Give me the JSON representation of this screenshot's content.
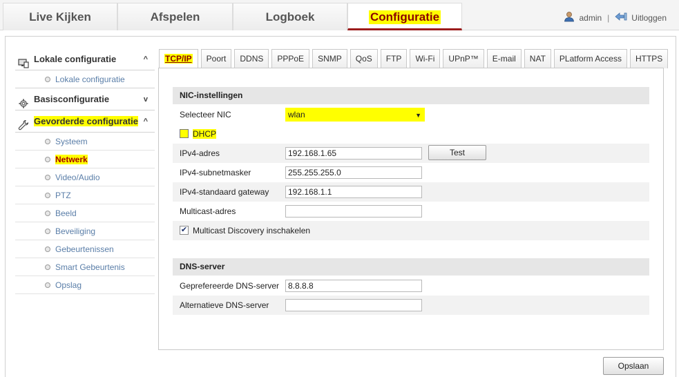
{
  "nav": {
    "tabs": [
      {
        "label": "Live Kijken",
        "active": false
      },
      {
        "label": "Afspelen",
        "active": false
      },
      {
        "label": "Logboek",
        "active": false
      },
      {
        "label": "Configuratie",
        "active": true
      }
    ],
    "user": "admin",
    "separator": "|",
    "logout": "Uitloggen"
  },
  "sidebar": {
    "groups": [
      {
        "label": "Lokale configuratie",
        "icon": "monitor-icon",
        "chevron": "^",
        "items": [
          {
            "label": "Lokale configuratie"
          }
        ]
      },
      {
        "label": "Basisconfiguratie",
        "icon": "gear-icon",
        "chevron": "v",
        "items": []
      },
      {
        "label": "Gevorderde configuratie",
        "icon": "wrench-icon",
        "chevron": "^",
        "items": [
          {
            "label": "Systeem"
          },
          {
            "label": "Netwerk",
            "active": true
          },
          {
            "label": "Video/Audio"
          },
          {
            "label": "PTZ"
          },
          {
            "label": "Beeld"
          },
          {
            "label": "Beveiliging"
          },
          {
            "label": "Gebeurtenissen"
          },
          {
            "label": "Smart Gebeurtenis"
          },
          {
            "label": "Opslag"
          }
        ]
      }
    ]
  },
  "tabs": [
    "TCP/IP",
    "Poort",
    "DDNS",
    "PPPoE",
    "SNMP",
    "QoS",
    "FTP",
    "Wi-Fi",
    "UPnP™",
    "E-mail",
    "NAT",
    "PLatform Access",
    "HTTPS"
  ],
  "active_tab": "TCP/IP",
  "nic_section": {
    "title": "NIC-instellingen",
    "select_nic_label": "Selecteer NIC",
    "select_nic_value": "wlan",
    "dhcp_label": "DHCP",
    "dhcp_checked": false,
    "ipv4_address_label": "IPv4-adres",
    "ipv4_address_value": "192.168.1.65",
    "test_button": "Test",
    "ipv4_subnet_label": "IPv4-subnetmasker",
    "ipv4_subnet_value": "255.255.255.0",
    "ipv4_gateway_label": "IPv4-standaard gateway",
    "ipv4_gateway_value": "192.168.1.1",
    "multicast_label": "Multicast-adres",
    "multicast_value": "",
    "multicast_discovery_label": "Multicast Discovery inschakelen",
    "multicast_discovery_checked": true
  },
  "dns_section": {
    "title": "DNS-server",
    "preferred_label": "Geprefereerde DNS-server",
    "preferred_value": "8.8.8.8",
    "alternate_label": "Alternatieve DNS-server",
    "alternate_value": ""
  },
  "save_button": "Opslaan",
  "colors": {
    "highlight": "#ffff00",
    "active_red": "#8b0000",
    "link_blue": "#5a7ea8"
  }
}
